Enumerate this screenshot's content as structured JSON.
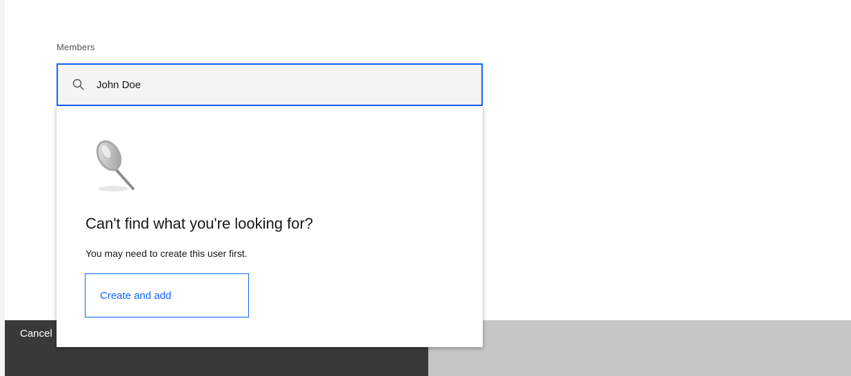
{
  "field": {
    "label": "Members",
    "value": "John Doe",
    "icon": "search-icon"
  },
  "empty_state": {
    "icon": "magnifying-glass-illustration",
    "title": "Can't find what you're looking for?",
    "text": "You may need to create this user first.",
    "action_label": "Create and add"
  },
  "footer": {
    "cancel_label": "Cancel"
  },
  "colors": {
    "accent": "#0f62fe",
    "field_bg": "#f4f4f4",
    "footer_dark": "#393939",
    "footer_light": "#c6c6c6",
    "text_primary": "#161616",
    "text_secondary": "#525252"
  }
}
